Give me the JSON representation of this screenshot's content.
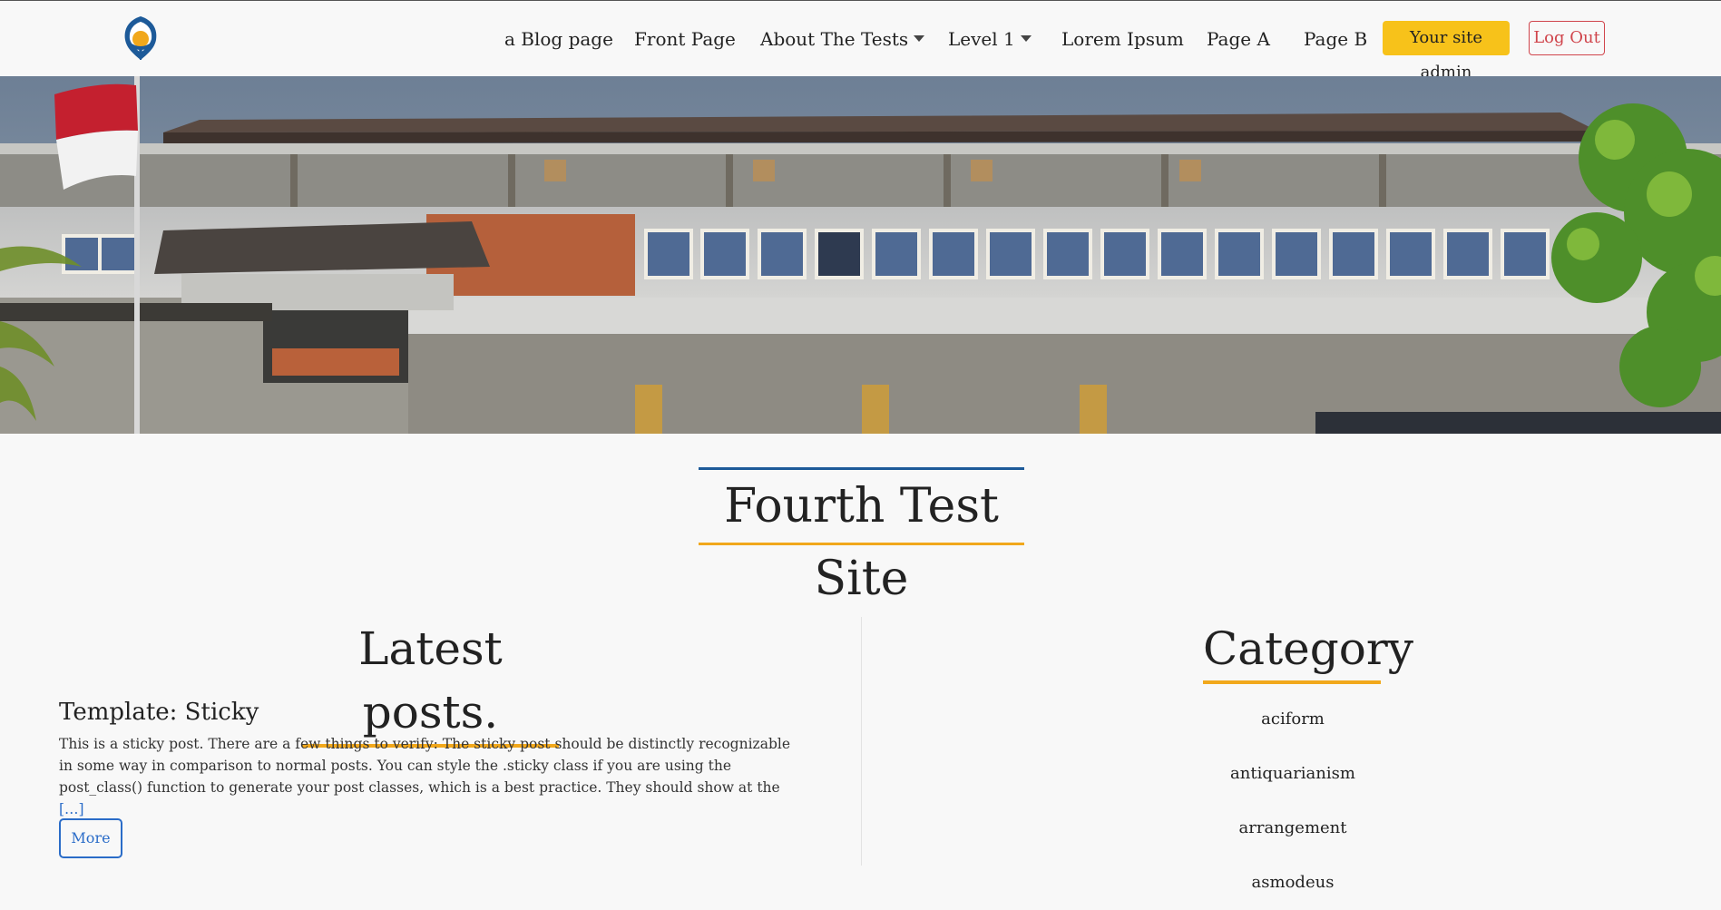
{
  "nav": {
    "items": [
      {
        "label": "a Blog page",
        "dropdown": false
      },
      {
        "label": "Front Page",
        "dropdown": false
      },
      {
        "label": "About The Tests",
        "dropdown": true
      },
      {
        "label": "Level 1",
        "dropdown": true
      },
      {
        "label": "Lorem Ipsum",
        "dropdown": false
      },
      {
        "label": "Page A",
        "dropdown": false
      },
      {
        "label": "Page B",
        "dropdown": false
      }
    ],
    "admin_label": "Your site admin",
    "logout_label": "Log Out"
  },
  "site": {
    "title": "Fourth Test Site"
  },
  "posts": {
    "heading": "Latest posts.",
    "items": [
      {
        "title": "Template: Sticky",
        "excerpt": "This is a sticky post. There are a few things to verify: The sticky post should be distinctly recognizable in some way in comparison to normal posts. You can style the .sticky class if you are using the post_class() function to generate your post classes, which is a best practice. They should show at the ",
        "more_link": "[…]",
        "button": "More"
      }
    ]
  },
  "category": {
    "heading": "Category",
    "items": [
      "aciform",
      "antiquarianism",
      "arrangement",
      "asmodeus"
    ]
  },
  "colors": {
    "accent_gold": "#f1a81c",
    "accent_blue": "#1d5a99",
    "admin_button": "#f7c21a",
    "logout_red": "#d0454c",
    "link_blue": "#2a6cc8"
  }
}
